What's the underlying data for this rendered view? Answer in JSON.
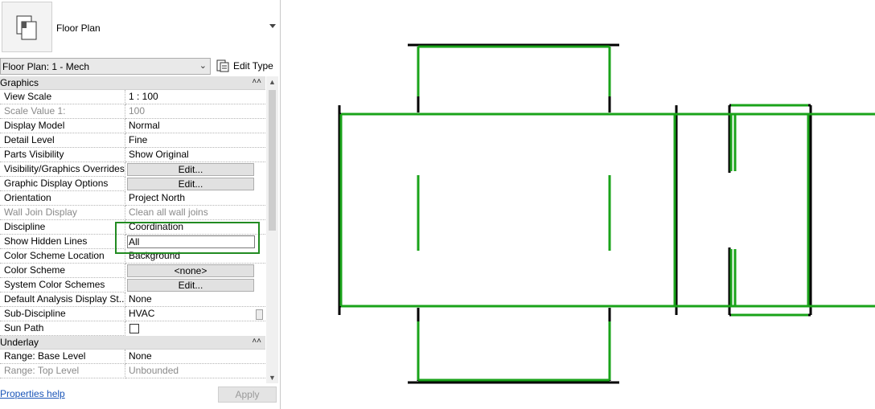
{
  "type_selector": {
    "name": "Floor Plan",
    "icon": "floor-plan-icon"
  },
  "instance_selector": {
    "value": "Floor Plan: 1 - Mech",
    "edit_type_label": "Edit Type"
  },
  "groups": {
    "graphics": {
      "label": "Graphics",
      "rows": [
        {
          "name": "View Scale",
          "value": "1 : 100",
          "kind": "text",
          "disabled": false
        },
        {
          "name": "Scale Value    1:",
          "value": "100",
          "kind": "text",
          "disabled": true
        },
        {
          "name": "Display Model",
          "value": "Normal",
          "kind": "text",
          "disabled": false
        },
        {
          "name": "Detail Level",
          "value": "Fine",
          "kind": "text",
          "disabled": false
        },
        {
          "name": "Parts Visibility",
          "value": "Show Original",
          "kind": "text",
          "disabled": false
        },
        {
          "name": "Visibility/Graphics Overrides",
          "value": "Edit...",
          "kind": "button",
          "disabled": false
        },
        {
          "name": "Graphic Display Options",
          "value": "Edit...",
          "kind": "button",
          "disabled": false
        },
        {
          "name": "Orientation",
          "value": "Project North",
          "kind": "text",
          "disabled": false
        },
        {
          "name": "Wall Join Display",
          "value": "Clean all wall joins",
          "kind": "text",
          "disabled": true
        },
        {
          "name": "Discipline",
          "value": "Coordination",
          "kind": "text",
          "disabled": false
        },
        {
          "name": "Show Hidden Lines",
          "value": "All",
          "kind": "input",
          "disabled": false
        },
        {
          "name": "Color Scheme Location",
          "value": "Background",
          "kind": "text",
          "disabled": false
        },
        {
          "name": "Color Scheme",
          "value": "<none>",
          "kind": "button",
          "disabled": false
        },
        {
          "name": "System Color Schemes",
          "value": "Edit...",
          "kind": "button",
          "disabled": false
        },
        {
          "name": "Default Analysis Display St...",
          "value": "None",
          "kind": "text",
          "disabled": false
        },
        {
          "name": "Sub-Discipline",
          "value": "HVAC",
          "kind": "text",
          "disabled": false
        },
        {
          "name": "Sun Path",
          "value": "",
          "kind": "checkbox",
          "checked": false,
          "disabled": false
        }
      ]
    },
    "underlay": {
      "label": "Underlay",
      "rows": [
        {
          "name": "Range: Base Level",
          "value": "None",
          "kind": "text",
          "disabled": false
        },
        {
          "name": "Range: Top Level",
          "value": "Unbounded",
          "kind": "text",
          "disabled": true
        }
      ]
    }
  },
  "footer": {
    "help_link": "Properties help",
    "apply_label": "Apply"
  },
  "colors": {
    "wall_black": "#000000",
    "duct_green": "#1aa31a",
    "highlight": "#228b22",
    "link": "#1a55b8"
  }
}
